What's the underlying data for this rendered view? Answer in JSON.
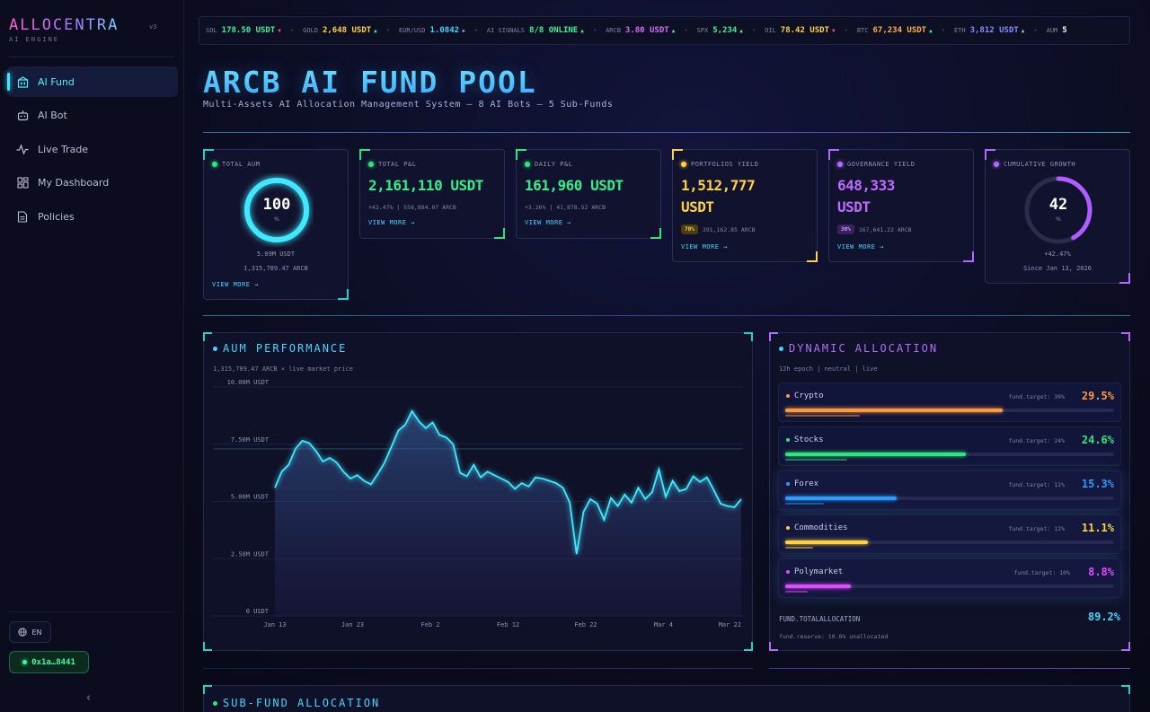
{
  "brand": {
    "name": "ALLOCENTRA",
    "version": "v3",
    "subtitle": "AI ENGINE"
  },
  "sidebar": {
    "items": [
      {
        "label": "AI Fund",
        "icon": "building-icon",
        "active": true
      },
      {
        "label": "AI Bot",
        "icon": "bot-icon"
      },
      {
        "label": "Live Trade",
        "icon": "pulse-icon"
      },
      {
        "label": "My Dashboard",
        "icon": "dashboard-icon"
      },
      {
        "label": "Policies",
        "icon": "document-icon"
      }
    ],
    "language": "EN",
    "wallet": "0x1a…8441"
  },
  "ticker": [
    {
      "name": "SOL",
      "value": "178.50 USDT",
      "dir": "▼",
      "color": "#3ef09a",
      "arrow_color": "#ff4f7a"
    },
    {
      "name": "GOLD",
      "value": "2,648 USDT",
      "dir": "▲",
      "color": "#ffd23f",
      "arrow_color": "#3ef09a"
    },
    {
      "name": "EUR/USD",
      "value": "1.0842",
      "dir": "◆",
      "color": "#3fd6ff",
      "arrow_color": "#8e93b8"
    },
    {
      "name": "AI SIGNALS",
      "value": "8/8 ONLINE",
      "dir": "▲",
      "color": "#3ef09a",
      "arrow_color": "#3ef09a"
    },
    {
      "name": "ARCB",
      "value": "3.80 USDT",
      "dir": "▲",
      "color": "#d66bff",
      "arrow_color": "#3ef09a"
    },
    {
      "name": "SPX",
      "value": "5,234",
      "dir": "▲",
      "color": "#3ef09a",
      "arrow_color": "#3ef09a"
    },
    {
      "name": "OIL",
      "value": "78.42 USDT",
      "dir": "▼",
      "color": "#ffd23f",
      "arrow_color": "#ff4f7a"
    },
    {
      "name": "BTC",
      "value": "67,234 USDT",
      "dir": "▲",
      "color": "#ffb03f",
      "arrow_color": "#3ef09a"
    },
    {
      "name": "ETH",
      "value": "3,812 USDT",
      "dir": "▲",
      "color": "#8a8cff",
      "arrow_color": "#3ef09a"
    },
    {
      "name": "AUM",
      "value": "5",
      "dir": "",
      "color": "#ffffff",
      "arrow_color": "#3ef09a"
    }
  ],
  "header": {
    "title": "ARCB AI FUND POOL",
    "subtitle": "Multi-Assets AI Allocation Management System — 8 AI Bots — 5 Sub-Funds"
  },
  "cards": {
    "total_aum": {
      "label": "TOTAL AUM",
      "ring_value": "100",
      "ring_unit": "%",
      "fill": 1.0,
      "line1": "5.09M USDT",
      "line2": "1,315,789.47 ARCB",
      "link": "VIEW MORE →"
    },
    "total_pl": {
      "label": "TOTAL P&L",
      "value": "2,161,110 USDT",
      "sub": "+42.47% | 558,884.07 ARCB",
      "link": "VIEW MORE →"
    },
    "daily_pl": {
      "label": "DAILY P&L",
      "value": "161,960 USDT",
      "sub": "+3.26% | 41,878.52 ARCB",
      "link": "VIEW MORE →"
    },
    "portfolios_yield": {
      "label": "PORTFOLIOS YIELD",
      "value_line1": "1,512,777",
      "value_line2": "USDT",
      "badge": "70%",
      "sub": "391,162.85 ARCB",
      "link": "VIEW MORE →"
    },
    "governance_yield": {
      "label": "GOVERNANCE YIELD",
      "value_line1": "648,333",
      "value_line2": "USDT",
      "badge": "30%",
      "sub": "167,641.22 ARCB",
      "link": "VIEW MORE →"
    },
    "cumulative_growth": {
      "label": "CUMULATIVE GROWTH",
      "ring_value": "42",
      "ring_unit": "%",
      "fill": 0.42,
      "line1": "+42.47%",
      "line2": "Since Jan 13, 2026"
    }
  },
  "aum_panel": {
    "title": "AUM PERFORMANCE",
    "subtitle": "1,315,789.47 ARCB × live market price"
  },
  "chart_data": {
    "type": "area",
    "title": "AUM PERFORMANCE",
    "ylabel": "",
    "xlabel": "",
    "ylim": [
      0,
      10
    ],
    "yticks": [
      "10.00M USDT",
      "7.50M USDT",
      "5.00M USDT",
      "2.50M USDT",
      "0 USDT"
    ],
    "xticks": [
      "Jan 13",
      "Jan 23",
      "Feb 2",
      "Feb 12",
      "Feb 22",
      "Mar 4",
      "Mar 22"
    ],
    "series": [
      {
        "values": [
          5.6,
          6.3,
          6.6,
          7.3,
          7.65,
          7.55,
          7.2,
          6.75,
          6.9,
          6.7,
          6.3,
          6.0,
          6.15,
          5.9,
          5.75,
          6.2,
          6.7,
          7.4,
          8.1,
          8.35,
          8.95,
          8.5,
          8.2,
          8.45,
          7.9,
          7.8,
          7.5,
          6.25,
          6.1,
          6.6,
          6.05,
          6.3,
          6.15,
          6.0,
          5.85,
          5.55,
          5.8,
          5.65,
          6.05,
          6.0,
          5.9,
          5.8,
          5.6,
          4.95,
          2.7,
          4.55,
          5.1,
          4.9,
          4.2,
          5.15,
          4.8,
          5.3,
          4.95,
          5.6,
          5.1,
          5.4,
          6.4,
          5.2,
          5.9,
          5.45,
          5.55,
          6.1,
          5.85,
          6.05,
          5.5,
          4.9,
          4.8,
          4.75,
          5.1
        ]
      }
    ],
    "reference_line": 7.3
  },
  "allocation": {
    "title": "DYNAMIC ALLOCATION",
    "subtitle": "12h epoch | neutral | live",
    "rows": [
      {
        "name": "Crypto",
        "target": "fund.target: 30%",
        "pct": "29.5%",
        "color": "#ff9a3c",
        "fill": 0.66
      },
      {
        "name": "Stocks",
        "target": "fund.target: 24%",
        "pct": "24.6%",
        "color": "#2ee67a",
        "fill": 0.55
      },
      {
        "name": "Forex",
        "target": "fund.target: 12%",
        "pct": "15.3%",
        "color": "#2a9bff",
        "fill": 0.34
      },
      {
        "name": "Commodities",
        "target": "fund.target: 12%",
        "pct": "11.1%",
        "color": "#ffd23f",
        "fill": 0.25
      },
      {
        "name": "Polymarket",
        "target": "fund.target: 10%",
        "pct": "8.8%",
        "color": "#e04bff",
        "fill": 0.2
      }
    ],
    "total_label": "FUND.TOTALALLOCATION",
    "total_value": "89.2%",
    "reserve": "fund.reserve: 10.8% unallocated"
  },
  "subfund": {
    "title": "SUB-FUND ALLOCATION"
  }
}
